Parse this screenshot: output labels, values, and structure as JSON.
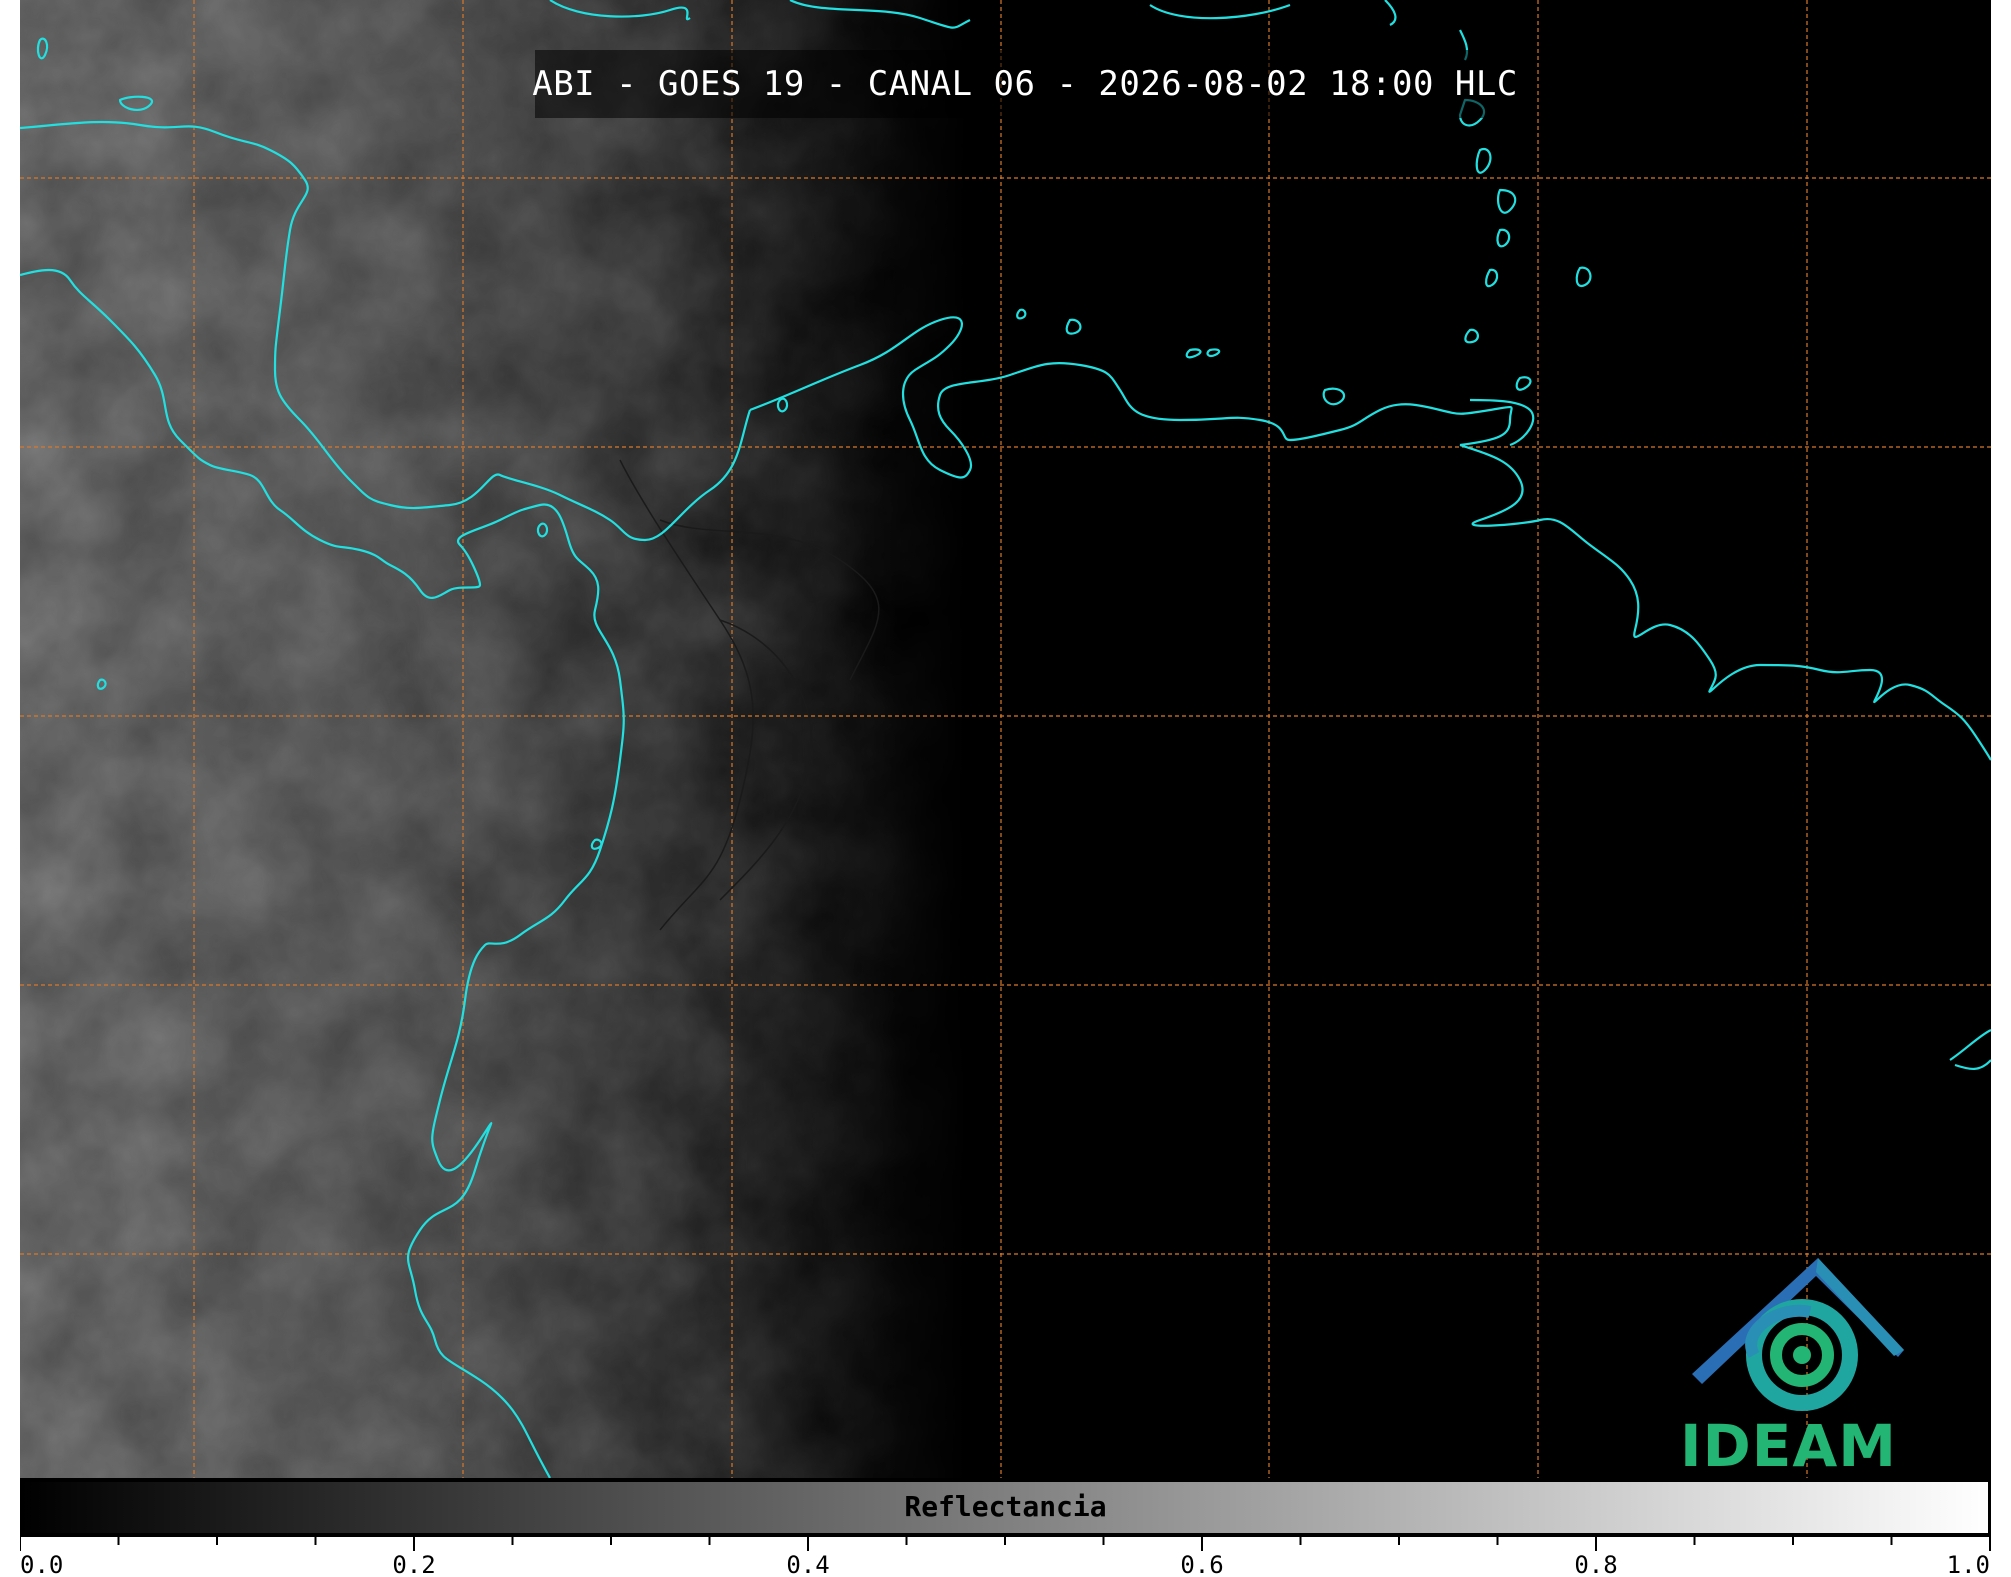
{
  "title": "ABI - GOES 19 - CANAL 06 - 2026-08-02 18:00 HLC",
  "logo": {
    "name": "IDEAM",
    "text": "IDEAM",
    "colors": [
      "#2a6fb5",
      "#1fa6a0",
      "#22b573"
    ]
  },
  "colorbar": {
    "label": "Reflectancia",
    "min": 0.0,
    "max": 1.0,
    "tick_labels": [
      "0.0",
      "0.2",
      "0.4",
      "0.6",
      "0.8",
      "1.0"
    ],
    "minor_step": 0.05
  },
  "colors": {
    "coastline": "#22e0e0",
    "grid": "#d9782a",
    "background": "#000000",
    "border_lines": "#111111"
  },
  "map": {
    "grid_columns": 8,
    "grid_rows": 6,
    "gridlines": "dashed"
  }
}
